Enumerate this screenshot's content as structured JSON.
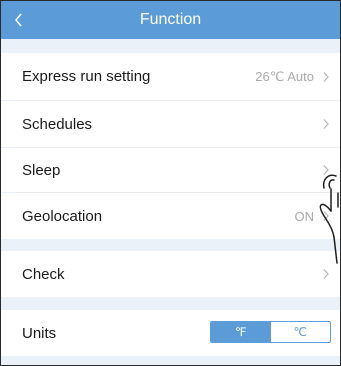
{
  "header": {
    "title": "Function"
  },
  "rows": [
    {
      "label": "Express run setting",
      "value": "26℃ Auto"
    },
    {
      "label": "Schedules",
      "value": ""
    },
    {
      "label": "Sleep",
      "value": ""
    },
    {
      "label": "Geolocation",
      "value": "ON"
    },
    {
      "label": "Check",
      "value": ""
    },
    {
      "label": "Units",
      "value": ""
    }
  ],
  "units": {
    "options": [
      "℉",
      "℃"
    ],
    "selected": "℉"
  },
  "colors": {
    "accent": "#5b9bd8",
    "section_bg": "#eaf1f8"
  }
}
